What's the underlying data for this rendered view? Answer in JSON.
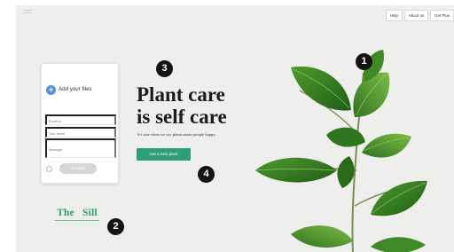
{
  "nav": {
    "items": [
      "Help",
      "About us",
      "Get Plus"
    ]
  },
  "upload_card": {
    "title": "Add your files",
    "fields": [
      {
        "placeholder": "Email to"
      },
      {
        "placeholder": "Your email"
      },
      {
        "placeholder": "Message"
      }
    ],
    "transfer_label": "Transfer"
  },
  "hero": {
    "headline_line1": "Plant care",
    "headline_line2": "is self care",
    "subline": "It's true when we say plants make people happy.",
    "cta_label": "Get a new plant"
  },
  "logo": {
    "text": "The   Sill"
  },
  "markers": [
    "1",
    "2",
    "3",
    "4"
  ],
  "colors": {
    "accent_green": "#2e9e77",
    "logo_green": "#2c9d6e",
    "hero_bg": "#eeeeec",
    "plus_blue": "#5b8fd6",
    "marker_black": "#141414"
  },
  "icons": [
    "menu-icon",
    "plus-icon",
    "attach-icon",
    "plant-image"
  ]
}
